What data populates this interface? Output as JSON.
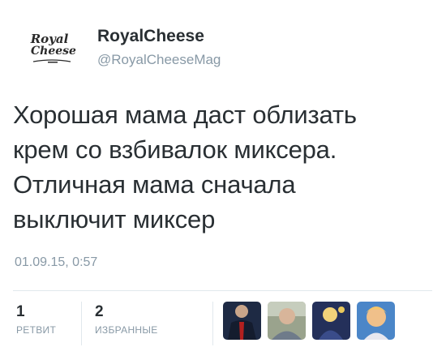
{
  "tweet": {
    "author": {
      "name": "RoyalCheese",
      "handle": "@RoyalCheeseMag",
      "logo_text": [
        "Royal",
        "Cheese"
      ]
    },
    "text_lines": [
      "Хорошая мама даст облизать",
      "крем со взбивалок миксера.",
      "Отличная мама сначала",
      "выключит миксер"
    ],
    "timestamp": "01.09.15, 0:57",
    "stats": {
      "retweets": {
        "count": "1",
        "label": "РЕТВИТ"
      },
      "favorites": {
        "count": "2",
        "label": "ИЗБРАННЫЕ"
      }
    },
    "favorited_by": [
      {
        "icon": "user-avatar-man-red-tie"
      },
      {
        "icon": "user-avatar-man-outdoors"
      },
      {
        "icon": "user-avatar-blonde-figure"
      },
      {
        "icon": "user-avatar-cartoon-girl"
      }
    ]
  },
  "colors": {
    "text": "#292f33",
    "muted": "#8899a6",
    "divider": "#e1e8ed",
    "background": "#ffffff"
  }
}
